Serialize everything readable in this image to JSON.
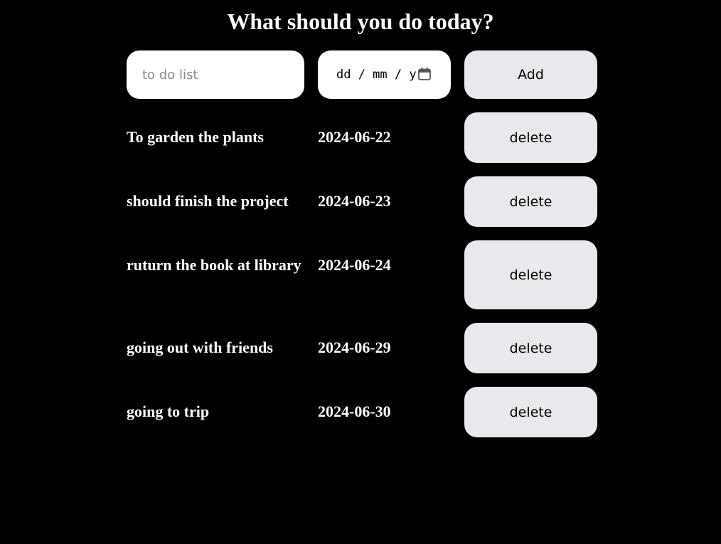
{
  "header": {
    "title": "What should you do today?"
  },
  "form": {
    "todo_placeholder": "to do list",
    "todo_value": "",
    "date_placeholder": "dd / mm / yyyy",
    "add_label": "Add"
  },
  "todos": [
    {
      "text": "To garden the plants",
      "date": "2024-06-22",
      "delete_label": "delete"
    },
    {
      "text": "should finish the project",
      "date": "2024-06-23",
      "delete_label": "delete"
    },
    {
      "text": "ruturn the book at library",
      "date": "2024-06-24",
      "delete_label": "delete"
    },
    {
      "text": "going out with friends",
      "date": "2024-06-29",
      "delete_label": "delete"
    },
    {
      "text": "going to trip",
      "date": "2024-06-30",
      "delete_label": "delete"
    }
  ],
  "icons": {
    "calendar": "calendar-icon"
  },
  "colors": {
    "background": "#000000",
    "button_bg": "#e9e8ed",
    "text": "#ffffff"
  }
}
